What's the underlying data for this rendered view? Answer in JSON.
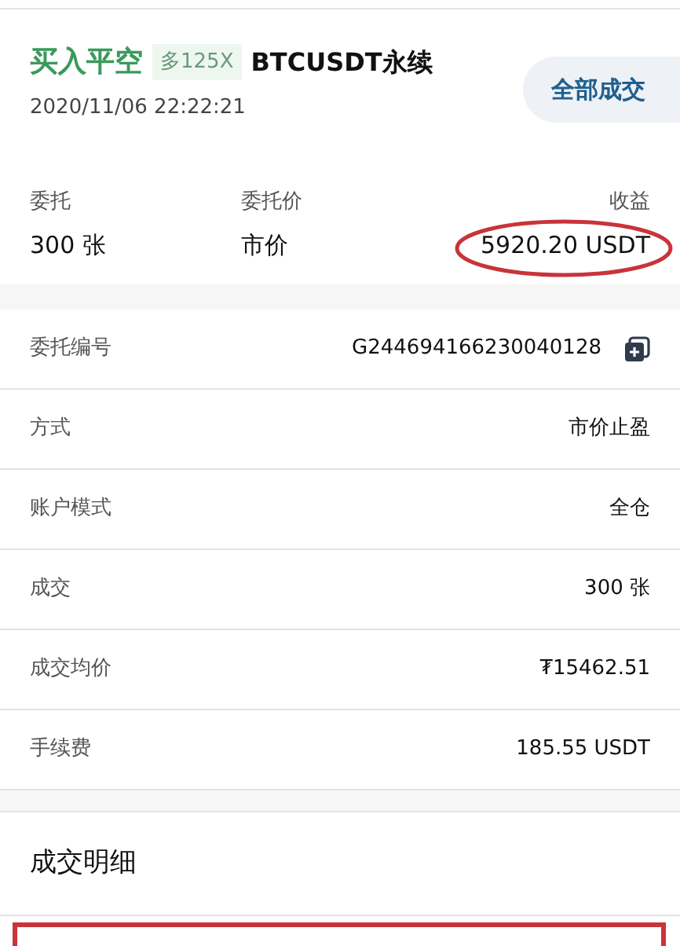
{
  "header": {
    "side": "买入平空",
    "leverage": "多125X",
    "symbol": "BTCUSDT永续",
    "time": "2020/11/06 22:22:21",
    "status_button": "全部成交"
  },
  "stats": [
    {
      "label": "委托",
      "value": "300 张"
    },
    {
      "label": "委托价",
      "value": "市价"
    },
    {
      "label": "收益",
      "value": "5920.20 USDT"
    }
  ],
  "details": [
    {
      "label": "委托编号",
      "value": "G244694166230040128",
      "copyable": true
    },
    {
      "label": "方式",
      "value": "市价止盈",
      "copyable": false
    },
    {
      "label": "账户模式",
      "value": "全仓",
      "copyable": false
    },
    {
      "label": "成交",
      "value": "300 张",
      "copyable": false
    },
    {
      "label": "成交均价",
      "value": "₮15462.51",
      "copyable": false
    },
    {
      "label": "手续费",
      "value": "185.55 USDT",
      "copyable": false
    }
  ],
  "section_title": "成交明细"
}
